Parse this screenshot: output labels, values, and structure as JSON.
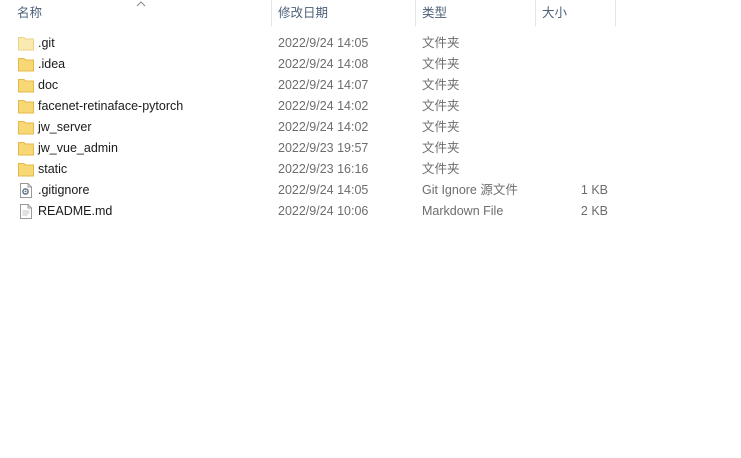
{
  "columns": {
    "name": "名称",
    "modified": "修改日期",
    "type": "类型",
    "size": "大小"
  },
  "files": [
    {
      "name": ".git",
      "modified": "2022/9/24 14:05",
      "type": "文件夹",
      "size": "",
      "icon": "folder-light-icon"
    },
    {
      "name": ".idea",
      "modified": "2022/9/24 14:08",
      "type": "文件夹",
      "size": "",
      "icon": "folder-icon"
    },
    {
      "name": "doc",
      "modified": "2022/9/24 14:07",
      "type": "文件夹",
      "size": "",
      "icon": "folder-icon"
    },
    {
      "name": "facenet-retinaface-pytorch",
      "modified": "2022/9/24 14:02",
      "type": "文件夹",
      "size": "",
      "icon": "folder-icon"
    },
    {
      "name": "jw_server",
      "modified": "2022/9/24 14:02",
      "type": "文件夹",
      "size": "",
      "icon": "folder-icon"
    },
    {
      "name": "jw_vue_admin",
      "modified": "2022/9/23 19:57",
      "type": "文件夹",
      "size": "",
      "icon": "folder-icon"
    },
    {
      "name": "static",
      "modified": "2022/9/23 16:16",
      "type": "文件夹",
      "size": "",
      "icon": "folder-icon"
    },
    {
      "name": ".gitignore",
      "modified": "2022/9/24 14:05",
      "type": "Git Ignore 源文件",
      "size": "1 KB",
      "icon": "gear-file-icon"
    },
    {
      "name": "README.md",
      "modified": "2022/9/24 10:06",
      "type": "Markdown File",
      "size": "2 KB",
      "icon": "text-file-icon"
    }
  ],
  "colors": {
    "folder": "#f8d775",
    "folder_light": "#fbeab0",
    "header_text": "#4c607a"
  }
}
